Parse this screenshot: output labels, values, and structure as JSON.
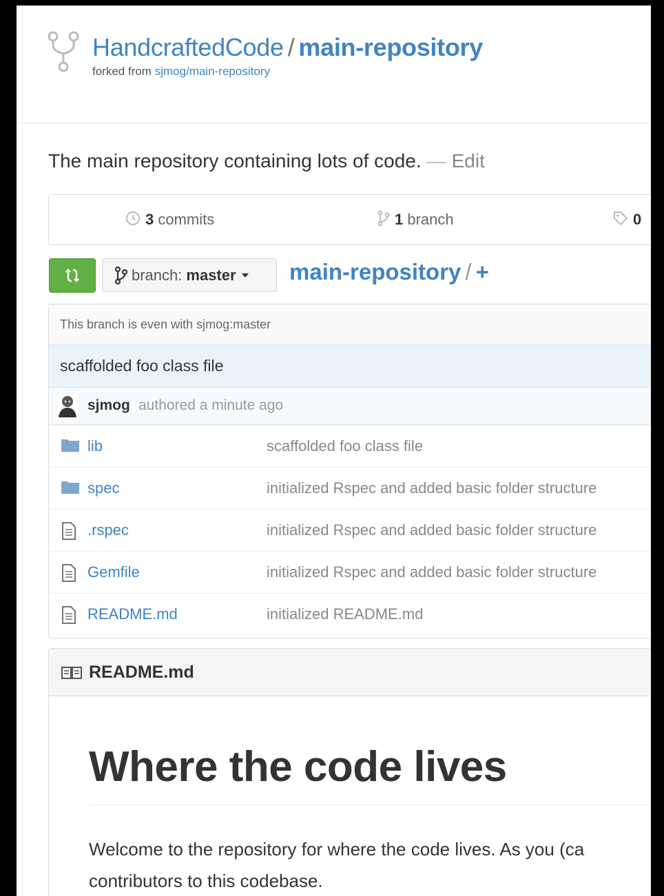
{
  "repo_header": {
    "owner": "HandcraftedCode",
    "separator": "/",
    "name": "main-repository",
    "forked_prefix": "forked from",
    "forked_source": "sjmog/main-repository"
  },
  "description": {
    "text": "The main repository containing lots of code.",
    "dash": "—",
    "edit_label": "Edit"
  },
  "numbers": {
    "commits_count": "3",
    "commits_label": "commits",
    "branches_count": "1",
    "branches_label": "branch",
    "releases_count": "0"
  },
  "toolbar": {
    "branch_label": "branch:",
    "branch_value": "master",
    "path_repo": "main-repository",
    "path_sep": "/",
    "path_plus": "+"
  },
  "file_browser": {
    "branch_status": "This branch is even with sjmog:master",
    "latest_commit": {
      "message": "scaffolded foo class file",
      "author": "sjmog",
      "time": "authored a minute ago"
    },
    "files": [
      {
        "type": "dir",
        "name": "lib",
        "message": "scaffolded foo class file"
      },
      {
        "type": "dir",
        "name": "spec",
        "message": "initialized Rspec and added basic folder structure"
      },
      {
        "type": "file",
        "name": ".rspec",
        "message": "initialized Rspec and added basic folder structure"
      },
      {
        "type": "file",
        "name": "Gemfile",
        "message": "initialized Rspec and added basic folder structure"
      },
      {
        "type": "file",
        "name": "README.md",
        "message": "initialized README.md"
      }
    ]
  },
  "readme": {
    "title": "README.md",
    "heading": "Where the code lives",
    "paragraph_line1": "Welcome to the repository for where the code lives. As you (ca",
    "paragraph_line2": "contributors to this codebase."
  },
  "colors": {
    "link": "#4183c4",
    "compare_button": "#60b044",
    "commit_highlight": "#eaf3f8"
  },
  "icons": [
    "repo-forked-icon",
    "commits-icon",
    "branch-icon",
    "tag-icon",
    "compare-icon",
    "folder-icon",
    "file-icon",
    "book-icon"
  ]
}
